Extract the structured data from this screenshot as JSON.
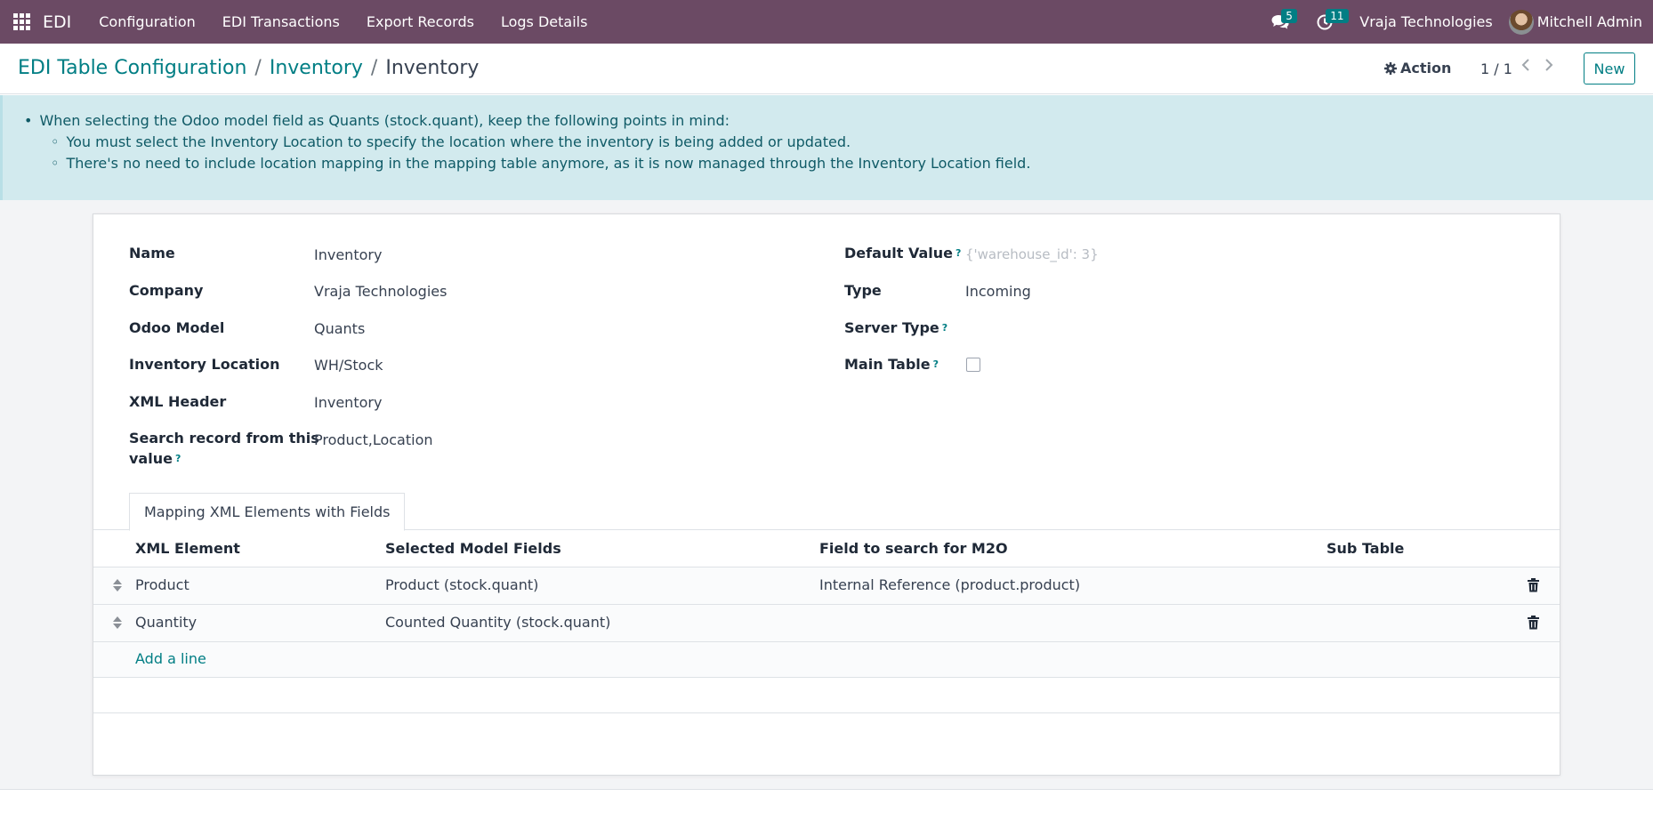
{
  "navbar": {
    "brand": "EDI",
    "menu": [
      "Configuration",
      "EDI Transactions",
      "Export Records",
      "Logs Details"
    ],
    "messages_count": "5",
    "activities_count": "11",
    "company": "Vraja Technologies",
    "user": "Mitchell Admin"
  },
  "breadcrumb": {
    "items": [
      "EDI Table Configuration",
      "Inventory"
    ],
    "separator": "/",
    "current": "Inventory"
  },
  "control": {
    "action_label": "Action",
    "pager": "1 / 1",
    "new_label": "New"
  },
  "alert": {
    "main": "When selecting the Odoo model field as Quants (stock.quant), keep the following points in mind:",
    "points": [
      "You must select the Inventory Location to specify the location where the inventory is being added or updated.",
      "There's no need to include location mapping in the mapping table anymore, as it is now managed through the Inventory Location field."
    ]
  },
  "form": {
    "left": [
      {
        "label": "Name",
        "value": "Inventory"
      },
      {
        "label": "Company",
        "value": "Vraja Technologies"
      },
      {
        "label": "Odoo Model",
        "value": "Quants"
      },
      {
        "label": "Inventory Location",
        "value": "WH/Stock"
      },
      {
        "label": "XML Header",
        "value": "Inventory"
      },
      {
        "label_line1": "Search record from this",
        "label_line2": "value",
        "value": "Product,Location"
      }
    ],
    "right": {
      "default_value_label": "Default Value",
      "default_value_placeholder": "{'warehouse_id': 3}",
      "type_label": "Type",
      "type_value": "Incoming",
      "server_type_label": "Server Type",
      "server_type_value": "",
      "main_table_label": "Main Table",
      "main_table_checked": false
    },
    "help_mark": "?"
  },
  "tab": {
    "label": "Mapping XML Elements with Fields"
  },
  "table": {
    "headers": [
      "XML Element",
      "Selected Model Fields",
      "Field to search for M2O",
      "Sub Table"
    ],
    "rows": [
      {
        "xml_element": "Product",
        "model_field": "Product (stock.quant)",
        "m2o_field": "Internal Reference (product.product)",
        "sub_table": ""
      },
      {
        "xml_element": "Quantity",
        "model_field": "Counted Quantity (stock.quant)",
        "m2o_field": "",
        "sub_table": ""
      }
    ],
    "add_line": "Add a line"
  },
  "colors": {
    "navbar": "#6b4a64",
    "accent": "#017e84",
    "alert_bg": "#d2eaee"
  }
}
